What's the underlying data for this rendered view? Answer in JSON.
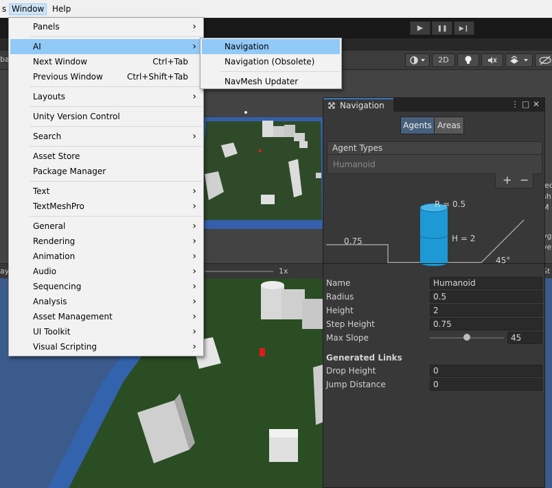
{
  "menubar": {
    "items": [
      {
        "label": "s"
      },
      {
        "label": "Window"
      },
      {
        "label": "Help"
      }
    ]
  },
  "toolbar": {
    "play_icon": "▶",
    "pause_icon": "❚❚",
    "step_icon": "▶❙"
  },
  "scene_toolbar": {
    "left_label": "ba",
    "toggle_2d": "2D"
  },
  "game_toolbar": {
    "left_label": "ay",
    "scale_label": "1x",
    "right_label": "St"
  },
  "scene_edge_texts": [
    "lec",
    "sh",
    "M",
    "yg",
    "ve"
  ],
  "window_menu": {
    "items": [
      {
        "label": "Panels",
        "arrow": "›"
      },
      {
        "label": "AI",
        "arrow": "›"
      },
      {
        "label": "Next Window",
        "shortcut": "Ctrl+Tab"
      },
      {
        "label": "Previous Window",
        "shortcut": "Ctrl+Shift+Tab"
      },
      {
        "label": "Layouts",
        "arrow": "›"
      },
      {
        "label": "Unity Version Control"
      },
      {
        "label": "Search",
        "arrow": "›"
      },
      {
        "label": "Asset Store"
      },
      {
        "label": "Package Manager"
      },
      {
        "label": "Text",
        "arrow": "›"
      },
      {
        "label": "TextMeshPro",
        "arrow": "›"
      },
      {
        "label": "General",
        "arrow": "›"
      },
      {
        "label": "Rendering",
        "arrow": "›"
      },
      {
        "label": "Animation",
        "arrow": "›"
      },
      {
        "label": "Audio",
        "arrow": "›"
      },
      {
        "label": "Sequencing",
        "arrow": "›"
      },
      {
        "label": "Analysis",
        "arrow": "›"
      },
      {
        "label": "Asset Management",
        "arrow": "›"
      },
      {
        "label": "UI Toolkit",
        "arrow": "›"
      },
      {
        "label": "Visual Scripting",
        "arrow": "›"
      }
    ]
  },
  "ai_submenu": {
    "items": [
      {
        "label": "Navigation"
      },
      {
        "label": "Navigation (Obsolete)"
      },
      {
        "label": "NavMesh Updater"
      }
    ]
  },
  "nav_window": {
    "tab_label": "Navigation",
    "menu_icon": "⋮",
    "maximize_icon": "□",
    "close_icon": "✕",
    "tabs": [
      {
        "label": "Agents"
      },
      {
        "label": "Areas"
      }
    ],
    "agent_types_header": "Agent Types",
    "agent_types_item": "Humanoid",
    "add_icon": "+",
    "remove_icon": "−",
    "diagram": {
      "radius_label": "R = 0.5",
      "height_label": "H = 2",
      "step_label": "0.75",
      "slope_label": "45°"
    },
    "fields": [
      {
        "label": "Name",
        "value": "Humanoid"
      },
      {
        "label": "Radius",
        "value": "0.5"
      },
      {
        "label": "Height",
        "value": "2"
      },
      {
        "label": "Step Height",
        "value": "0.75"
      }
    ],
    "max_slope": {
      "label": "Max Slope",
      "value": "45",
      "fraction": 0.5
    },
    "generated_links_header": "Generated Links",
    "link_fields": [
      {
        "label": "Drop Height",
        "value": "0"
      },
      {
        "label": "Jump Distance",
        "value": "0"
      }
    ]
  },
  "colors": {
    "highlight": "#91c9f7",
    "accent": "#3a79bb",
    "agent_cylinder": "#1d9ad6"
  }
}
